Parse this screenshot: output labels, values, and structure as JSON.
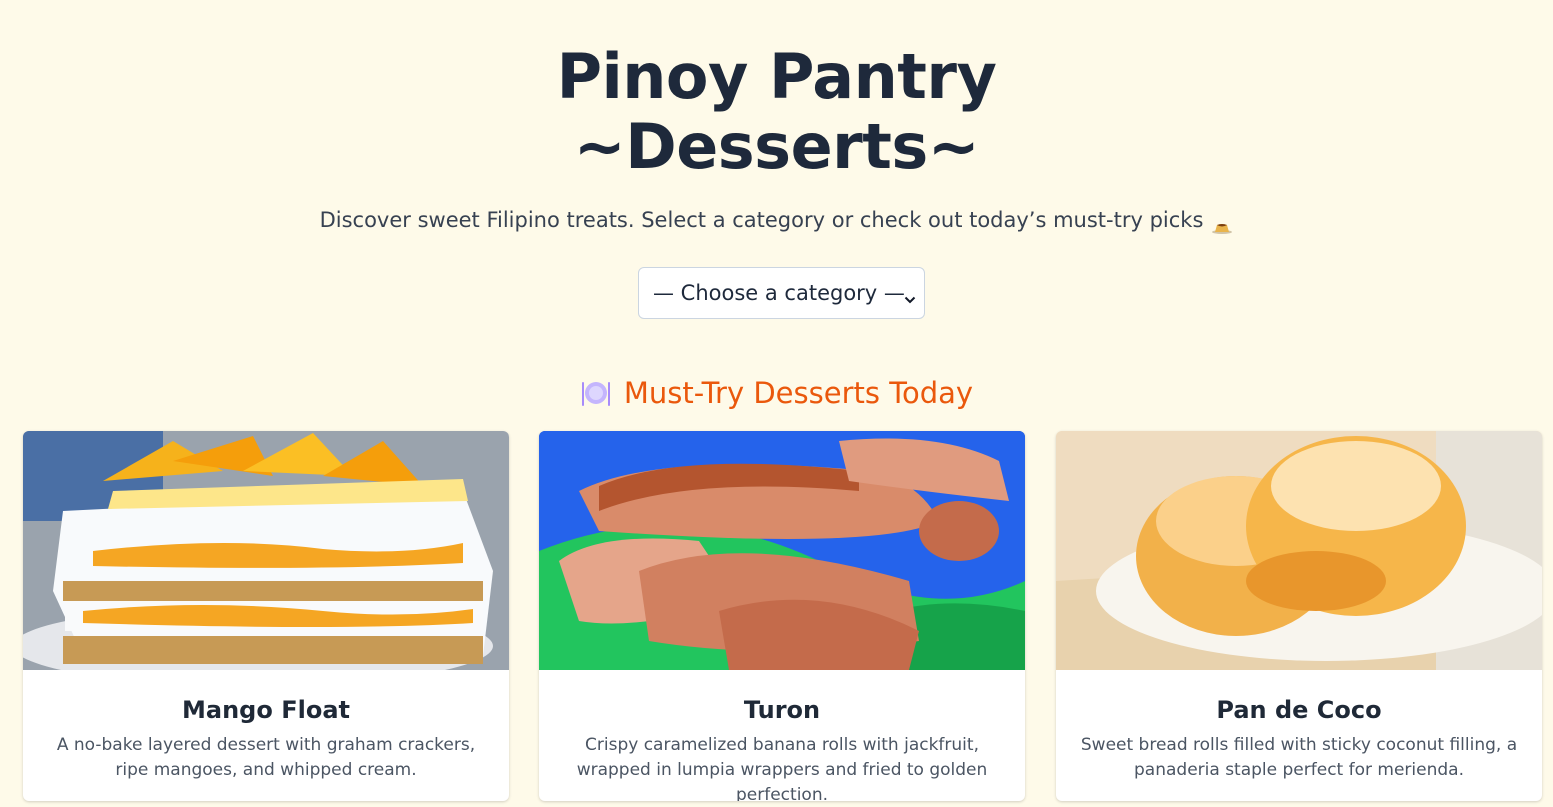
{
  "header": {
    "title_line1": "Pinoy Pantry",
    "title_line2": "~Desserts~",
    "subtitle": "Discover sweet Filipino treats. Select a category or check out today’s must-try picks"
  },
  "category_select": {
    "selected": "— Choose a category —"
  },
  "section": {
    "title": "Must-Try Desserts Today"
  },
  "cards": [
    {
      "title": "Mango Float",
      "description": "A no-bake layered dessert with graham crackers, ripe mangoes, and whipped cream."
    },
    {
      "title": "Turon",
      "description": "Crispy caramelized banana rolls with jackfruit, wrapped in lumpia wrappers and fried to golden perfection."
    },
    {
      "title": "Pan de Coco",
      "description": "Sweet bread rolls filled with sticky coconut filling, a panaderia staple perfect for merienda."
    }
  ],
  "colors": {
    "background": "#fefae9",
    "title": "#1e293b",
    "accent": "#ea580c"
  },
  "icons": {
    "subtitle_icon": "flan-icon",
    "section_icon": "plate-icon",
    "select_icon": "chevron-down-icon"
  }
}
